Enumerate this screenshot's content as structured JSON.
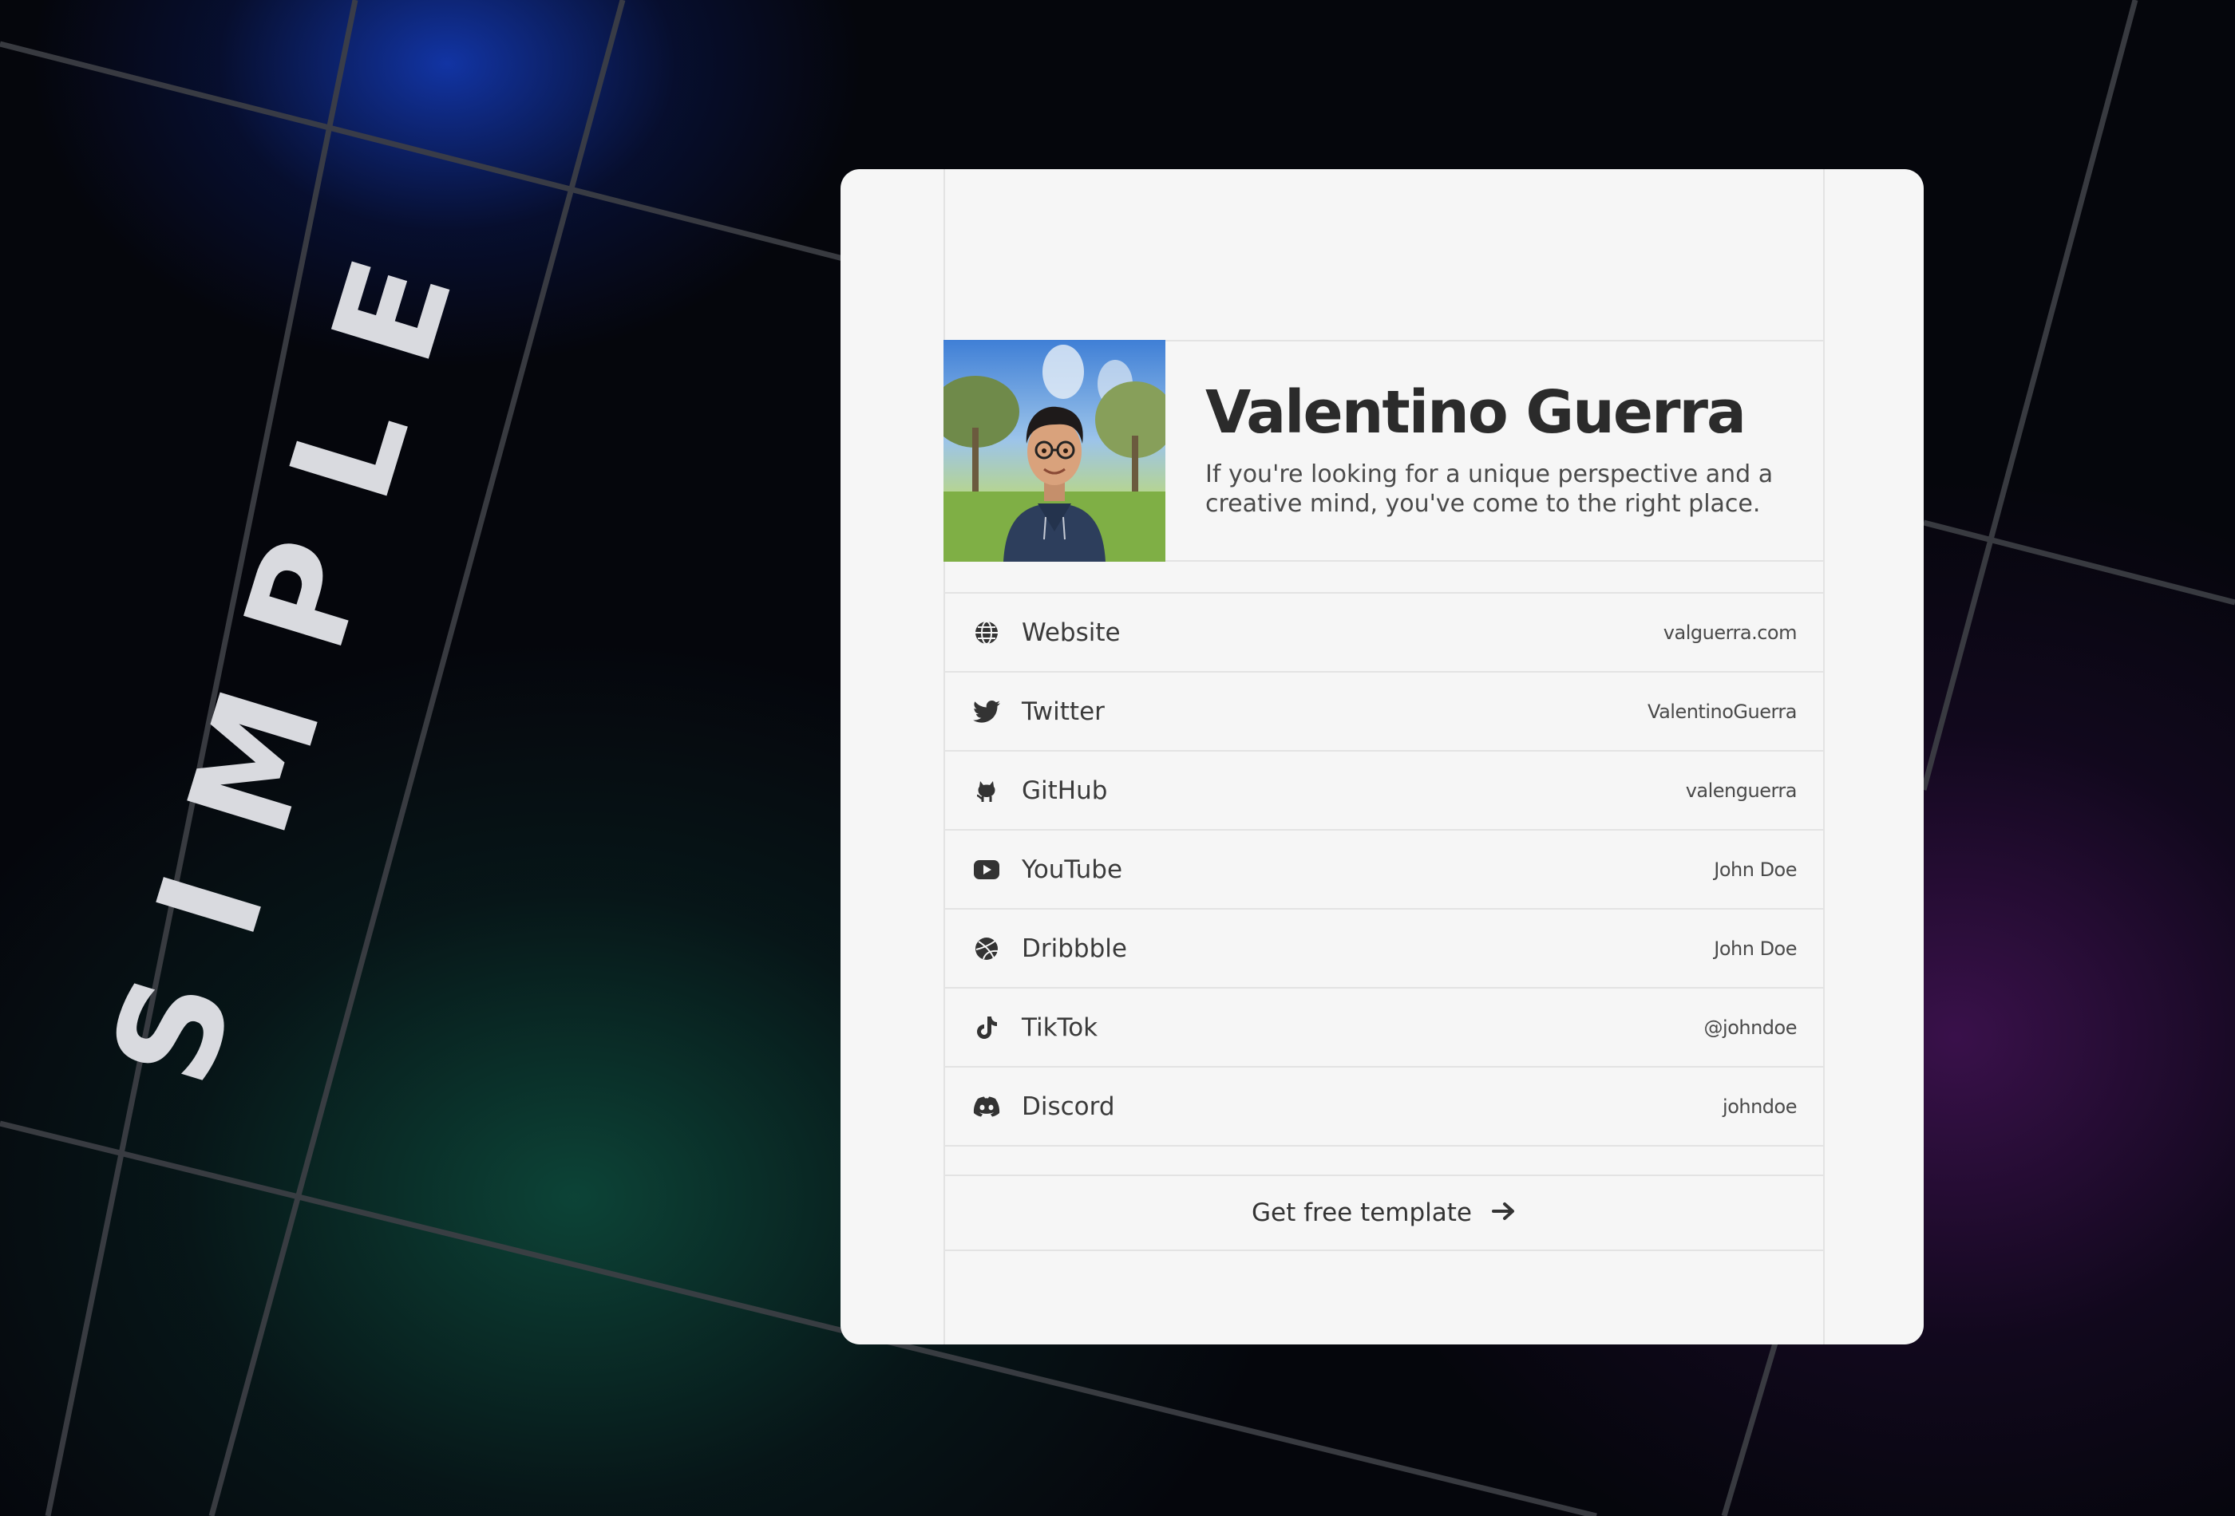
{
  "background": {
    "word": "SIMPLE"
  },
  "profile": {
    "name": "Valentino Guerra",
    "bio": "If you're looking for a unique perspective and a creative mind, you've come to the right place."
  },
  "links": [
    {
      "label": "Website",
      "value": "valguerra.com",
      "icon": "globe-icon"
    },
    {
      "label": "Twitter",
      "value": "ValentinoGuerra",
      "icon": "twitter-icon"
    },
    {
      "label": "GitHub",
      "value": "valenguerra",
      "icon": "github-icon"
    },
    {
      "label": "YouTube",
      "value": "John Doe",
      "icon": "youtube-icon"
    },
    {
      "label": "Dribbble",
      "value": "John Doe",
      "icon": "dribbble-icon"
    },
    {
      "label": "TikTok",
      "value": "@johndoe",
      "icon": "tiktok-icon"
    },
    {
      "label": "Discord",
      "value": "johndoe",
      "icon": "discord-icon"
    }
  ],
  "cta": {
    "label": "Get free template",
    "icon": "arrow-right-icon"
  },
  "colors": {
    "card": "#f6f6f6",
    "text": "#2b2b2b",
    "border": "#e3e3e3"
  }
}
